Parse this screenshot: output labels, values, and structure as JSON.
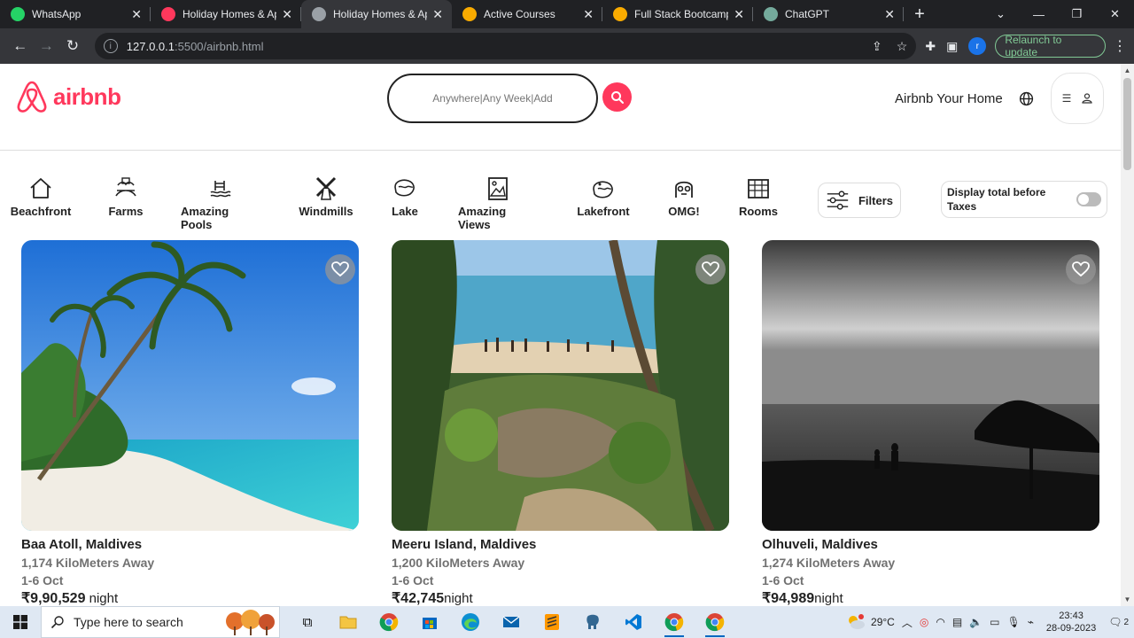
{
  "browser": {
    "tabs": [
      {
        "title": "WhatsApp",
        "favicon": "whatsapp-icon",
        "color": "#25d366",
        "active": false
      },
      {
        "title": "Holiday Homes & Ap…",
        "favicon": "airbnb-icon",
        "color": "#ff385c",
        "active": false
      },
      {
        "title": "Holiday Homes & Ap…",
        "favicon": "globe-icon",
        "color": "#9aa0a6",
        "active": true
      },
      {
        "title": "Active Courses",
        "favicon": "course-icon",
        "color": "#f9ab00",
        "active": false
      },
      {
        "title": "Full Stack Bootcamp (…",
        "favicon": "course-icon",
        "color": "#f9ab00",
        "active": false
      },
      {
        "title": "ChatGPT",
        "favicon": "chatgpt-icon",
        "color": "#74aa9c",
        "active": false
      }
    ],
    "url_host": "127.0.0.1",
    "url_path": ":5500/airbnb.html",
    "profile_initial": "r",
    "relaunch_label": "Relaunch to update"
  },
  "header": {
    "logo_text": "airbnb",
    "search_placeholder": "Anywhere|Any Week|Add",
    "host_link": "Airbnb Your Home",
    "brand_color": "#ff385c"
  },
  "categories": [
    {
      "label": "Beachfront",
      "icon": "house-icon"
    },
    {
      "label": "Farms",
      "icon": "farm-icon"
    },
    {
      "label": "Amazing Pools",
      "icon": "pool-icon"
    },
    {
      "label": "Windmills",
      "icon": "windmill-icon"
    },
    {
      "label": "Lake",
      "icon": "lake-icon"
    },
    {
      "label": "Amazing Views",
      "icon": "view-icon"
    },
    {
      "label": "Lakefront",
      "icon": "lakefront-icon"
    },
    {
      "label": "OMG!",
      "icon": "omg-icon"
    },
    {
      "label": "Rooms",
      "icon": "rooms-icon"
    }
  ],
  "filters_label": "Filters",
  "taxes_label": "Display total before Taxes",
  "taxes_toggle_on": false,
  "listings": [
    {
      "location": "Baa Atoll, Maldives",
      "distance": "1,174 KiloMeters Away",
      "dates": "1-6 Oct",
      "price": "₹9,90,529",
      "night": " night"
    },
    {
      "location": "Meeru Island, Maldives",
      "distance": "1,200 KiloMeters Away",
      "dates": "1-6 Oct",
      "price": "₹42,745",
      "night": "night"
    },
    {
      "location": "Olhuveli, Maldives",
      "distance": "1,274 KiloMeters Away",
      "dates": "1-6 Oct",
      "price": "₹94,989",
      "night": "night"
    }
  ],
  "taskbar": {
    "search_placeholder": "Type here to search",
    "weather": "29°C",
    "time": "23:43",
    "date": "28-09-2023",
    "notification_count": "2"
  }
}
